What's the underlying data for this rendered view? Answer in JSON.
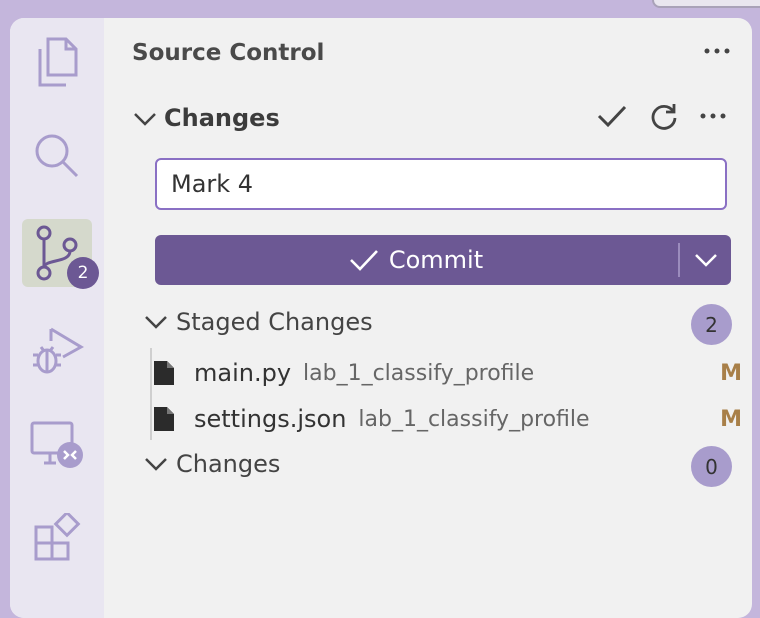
{
  "panel": {
    "title": "Source Control"
  },
  "changes_section": {
    "label": "Changes"
  },
  "commit_message": {
    "value": "Mark 4"
  },
  "commit_button": {
    "label": "Commit"
  },
  "activity_bar": {
    "items": [
      "explorer-icon",
      "search-icon",
      "source-control-icon",
      "run-debug-icon",
      "remote-explorer-icon",
      "extensions-icon"
    ],
    "source_control_badge": "2"
  },
  "staged": {
    "label": "Staged Changes",
    "count": "2",
    "files": [
      {
        "name": "main.py",
        "path": "lab_1_classify_profile",
        "status": "M"
      },
      {
        "name": "settings.json",
        "path": "lab_1_classify_profile",
        "status": "M"
      }
    ]
  },
  "unstaged": {
    "label": "Changes",
    "count": "0"
  },
  "colors": {
    "accent": "#6c5894",
    "border": "#8a70c4",
    "status_modified": "#a87f48"
  }
}
